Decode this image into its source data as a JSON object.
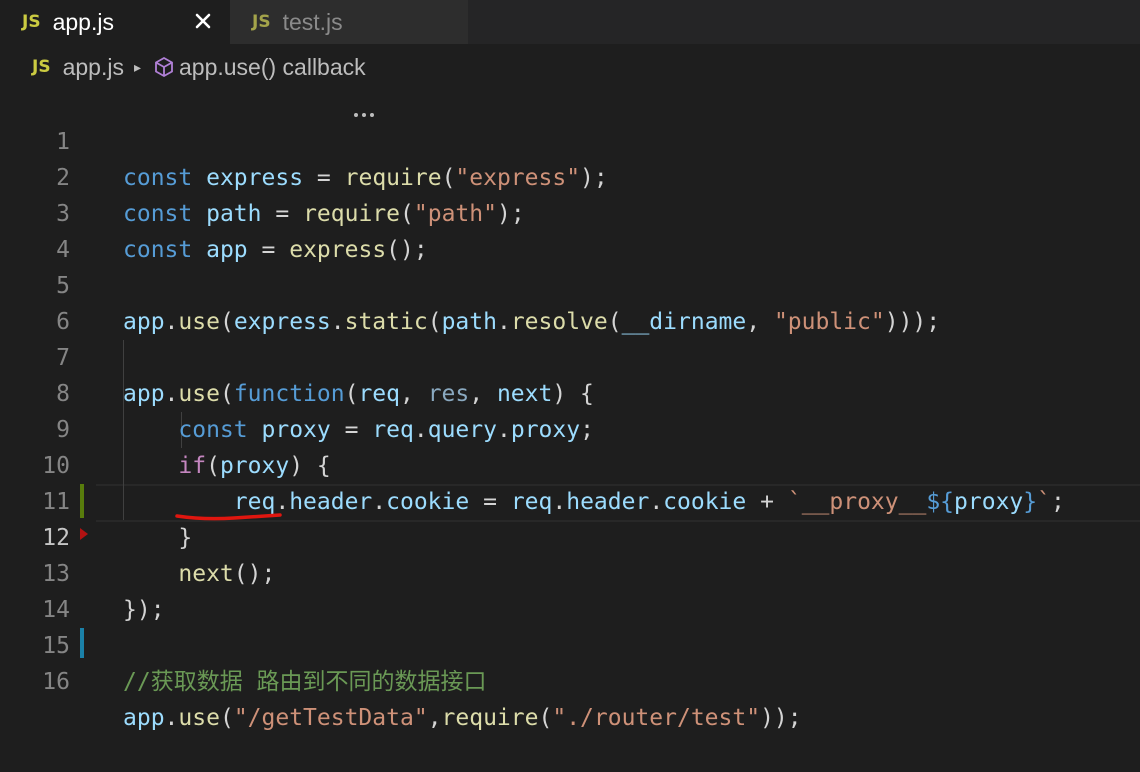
{
  "tabs": [
    {
      "label": "app.js",
      "badge": "JS",
      "active": true,
      "close_icon": "close-icon"
    },
    {
      "label": "test.js",
      "badge": "JS",
      "active": false
    }
  ],
  "breadcrumb": {
    "file_badge": "JS",
    "file": "app.js",
    "separator": "▸",
    "symbol_icon": "cube-symbol-icon",
    "symbol": "app.use() callback"
  },
  "editor": {
    "current_line": 12,
    "line_numbers": [
      "1",
      "2",
      "3",
      "4",
      "5",
      "6",
      "7",
      "8",
      "9",
      "10",
      "11",
      "12",
      "13",
      "14",
      "15",
      "16"
    ],
    "lines": [
      "const express = require(\"express\");",
      "const path = require(\"path\");",
      "const app = express();",
      "",
      "app.use(express.static(path.resolve(__dirname, \"public\")));",
      "",
      "app.use(function(req, res, next) {",
      "    const proxy = req.query.proxy;",
      "    if(proxy) {",
      "        req.header.cookie = req.header.cookie + `__proxy__${proxy}`;",
      "    }",
      "    next();",
      "});",
      "",
      "//获取数据 路由到不同的数据接口",
      "app.use(\"/getTestData\",require(\"./router/test\"));"
    ]
  },
  "colors": {
    "background": "#1e1e1e",
    "keyword": "#569cd6",
    "variable": "#9cdcfe",
    "function": "#dcdcaa",
    "string": "#ce9178",
    "comment": "#6a9955",
    "annotation_underline": "#e0160f",
    "gutter_modified": "#587c0c",
    "gutter_added": "#1b81a8"
  }
}
